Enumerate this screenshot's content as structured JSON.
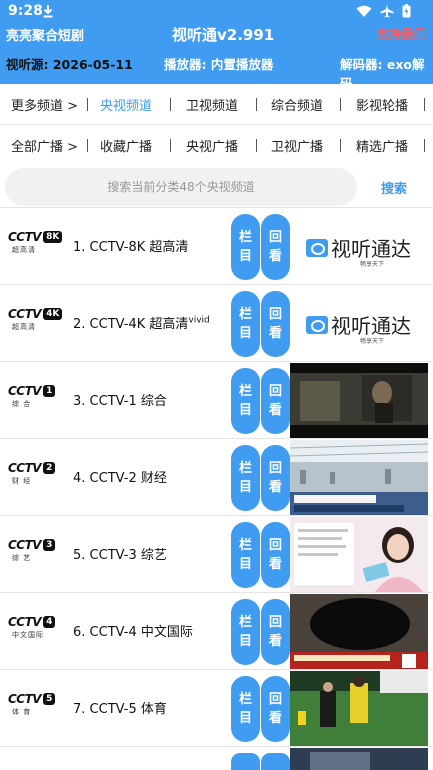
{
  "status_bar": {
    "time": "9:28"
  },
  "header": {
    "app_name": "亮亮聚合短剧",
    "title": "视听通v2.991",
    "support": "支持我们",
    "source_label": "视听源: 2026-05-11",
    "player_label": "播放器: 内置播放器",
    "decoder_label": "解码器: exo解码"
  },
  "tabs_row1": [
    {
      "label": "更多频道 >",
      "active": false
    },
    {
      "label": "央视频道",
      "active": true
    },
    {
      "label": "卫视频道",
      "active": false
    },
    {
      "label": "综合频道",
      "active": false
    },
    {
      "label": "影视轮播",
      "active": false
    }
  ],
  "tabs_row2": [
    {
      "label": "全部广播 >",
      "active": false
    },
    {
      "label": "收藏广播",
      "active": false
    },
    {
      "label": "央视广播",
      "active": false
    },
    {
      "label": "卫视广播",
      "active": false
    },
    {
      "label": "精选广播",
      "active": false
    }
  ],
  "search": {
    "placeholder": "搜索当前分类48个央视频道",
    "button": "搜索"
  },
  "row_buttons": {
    "column": "栏目",
    "replay": "回看"
  },
  "brand": {
    "name": "视听通达",
    "tagline": "畅享天下"
  },
  "channels": [
    {
      "logo_num": "8K",
      "logo_sub": "超高清",
      "name": "1. CCTV-8K 超高清",
      "sup": "",
      "thumb": "brand"
    },
    {
      "logo_num": "4K",
      "logo_sub": "超高清",
      "name": "2. CCTV-4K 超高清",
      "sup": "vivid",
      "thumb": "brand"
    },
    {
      "logo_num": "1",
      "logo_sub": "综 合",
      "name": "3. CCTV-1 综合",
      "sup": "",
      "thumb": "drama"
    },
    {
      "logo_num": "2",
      "logo_sub": "财 经",
      "name": "4. CCTV-2 财经",
      "sup": "",
      "thumb": "airport"
    },
    {
      "logo_num": "3",
      "logo_sub": "综 艺",
      "name": "5. CCTV-3 综艺",
      "sup": "",
      "thumb": "host"
    },
    {
      "logo_num": "4",
      "logo_sub": "中文国际",
      "name": "6. CCTV-4 中文国际",
      "sup": "",
      "thumb": "news"
    },
    {
      "logo_num": "5",
      "logo_sub": "体 育",
      "name": "7. CCTV-5 体育",
      "sup": "",
      "thumb": "soccer"
    }
  ],
  "colors": {
    "accent": "#3f9cf0",
    "support": "#ff5a5a",
    "active_tab": "#3f9cf0"
  }
}
